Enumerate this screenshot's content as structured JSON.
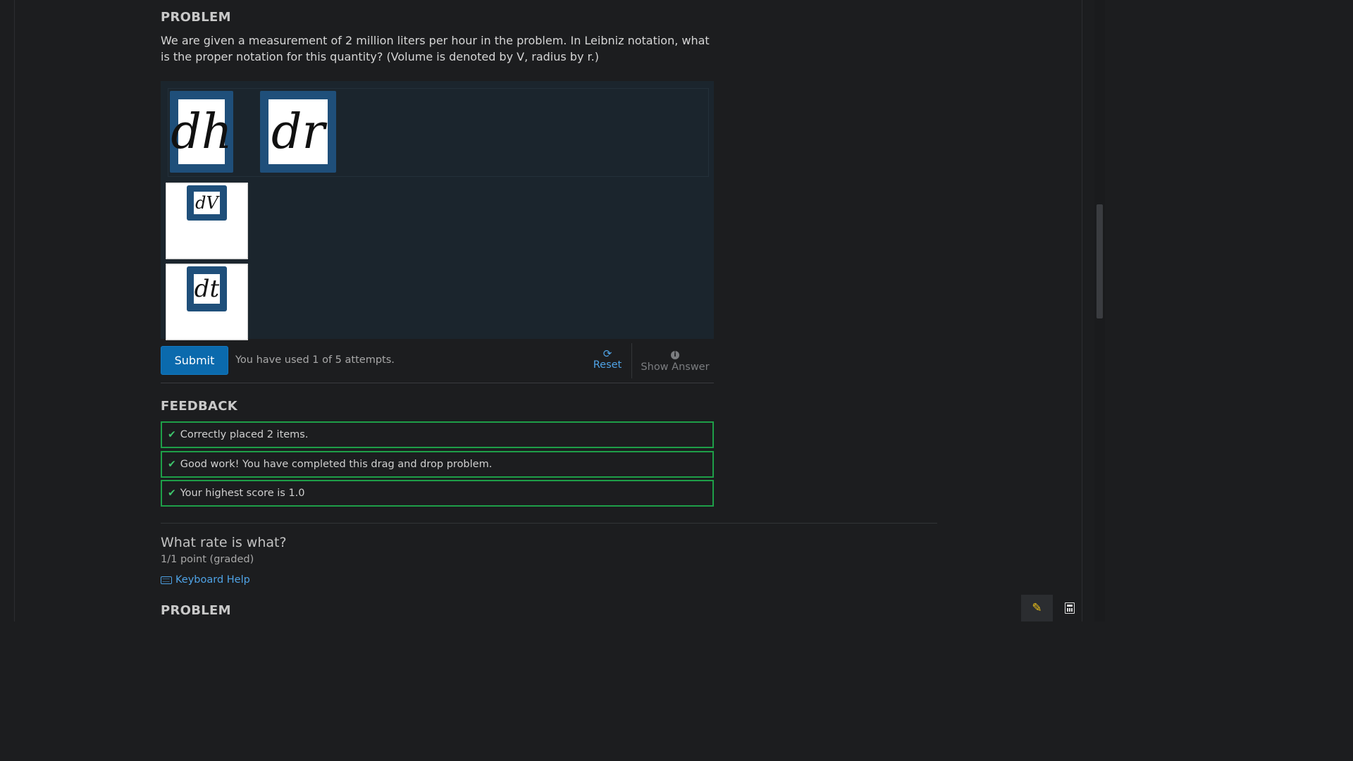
{
  "problem1": {
    "heading": "PROBLEM",
    "text": "We are given a measurement of 2 million liters per hour in the problem. In Leibniz notation, what is the proper notation for this quantity? (Volume is denoted by V, radius by r.)"
  },
  "dnd": {
    "bank_items": [
      {
        "label": "dh"
      },
      {
        "label": "dr"
      }
    ],
    "placed_items": [
      {
        "label": "dV"
      },
      {
        "label": "dt"
      }
    ]
  },
  "actions": {
    "submit_label": "Submit",
    "attempts_text": "You have used 1 of 5 attempts.",
    "reset_label": "Reset",
    "show_answer_label": "Show Answer"
  },
  "feedback": {
    "heading": "FEEDBACK",
    "messages": [
      "Correctly placed 2 items.",
      "Good work! You have completed this drag and drop problem.",
      "Your highest score is 1.0"
    ]
  },
  "next_question": {
    "title": "What rate is what?",
    "points": "1/1 point (graded)",
    "keyboard_help": "Keyboard Help",
    "heading": "PROBLEM"
  },
  "colors": {
    "background": "#1c1d1f",
    "accent_blue": "#0b6aad",
    "link_blue": "#4fa3e6",
    "success_green": "#1e9e48",
    "item_blue": "#1f4f7a"
  },
  "icons": {
    "check": "✔",
    "reset": "⟳",
    "info": "i",
    "pencil": "✎"
  }
}
